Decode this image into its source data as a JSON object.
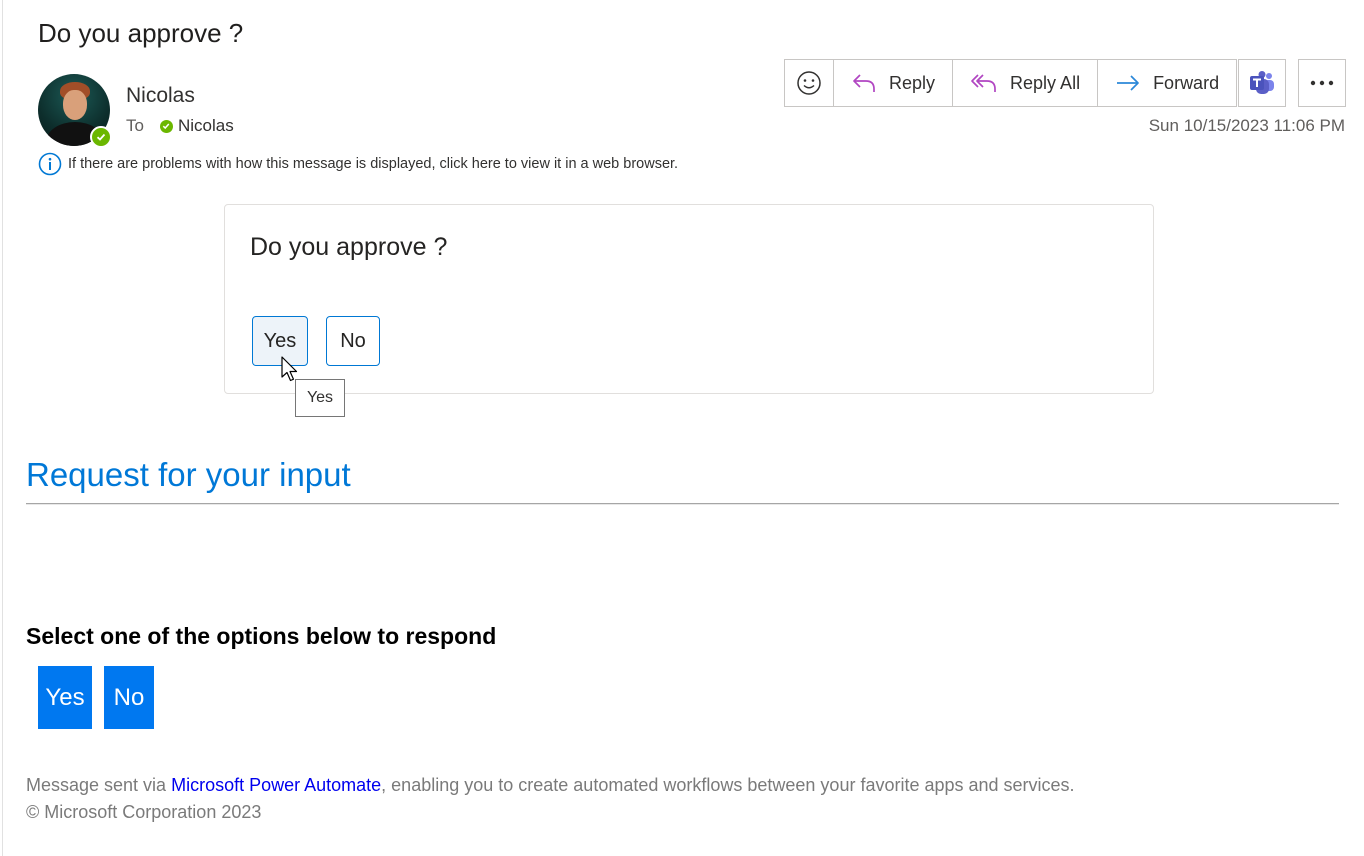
{
  "email": {
    "subject": "Do you approve ?",
    "sender": "Nicolas",
    "to_label": "To",
    "recipient": "Nicolas",
    "timestamp": "Sun 10/15/2023 11:06 PM",
    "info_message": "If there are problems with how this message is displayed, click here to view it in a web browser."
  },
  "toolbar": {
    "reply": "Reply",
    "reply_all": "Reply All",
    "forward": "Forward"
  },
  "card": {
    "title": "Do you approve ?",
    "yes": "Yes",
    "no": "No",
    "tooltip": "Yes"
  },
  "body": {
    "request_title": "Request for your input",
    "select_text": "Select one of the options below to respond",
    "yes": "Yes",
    "no": "No"
  },
  "footer": {
    "prefix": "Message sent via ",
    "link": "Microsoft Power Automate",
    "suffix": ", enabling you to create automated workflows between your favorite apps and services.",
    "copyright": "© Microsoft Corporation 2023"
  },
  "colors": {
    "accent": "#0078d4",
    "link_blue": "#0078d7",
    "action_button": "#0078f0",
    "presence_green": "#6bb700",
    "reply_icon": "#b146c2",
    "forward_icon": "#2b88d8",
    "teams_purple": "#5b5fc7"
  },
  "icons": [
    "emoji-icon",
    "reply-icon",
    "reply-all-icon",
    "forward-icon",
    "teams-icon",
    "more-icon",
    "info-icon",
    "presence-check-icon",
    "mouse-cursor-icon"
  ]
}
